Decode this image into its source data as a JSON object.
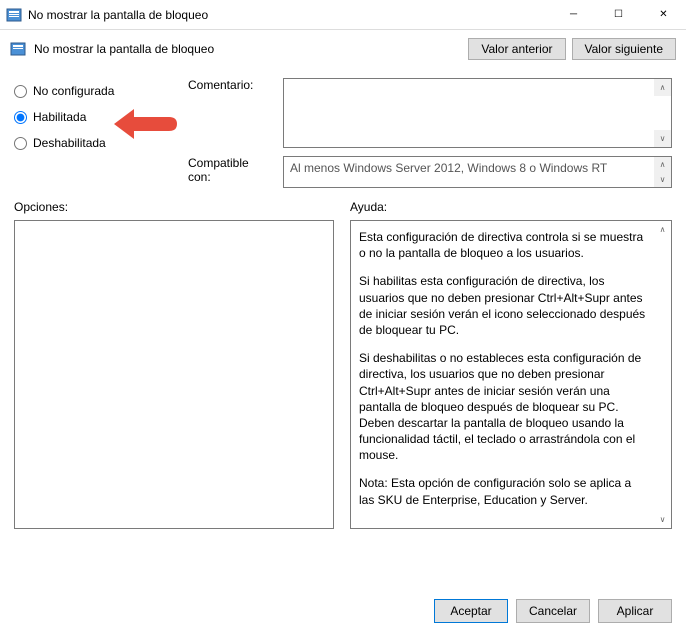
{
  "titlebar": {
    "title": "No mostrar la pantalla de bloqueo"
  },
  "subtitle": {
    "text": "No mostrar la pantalla de bloqueo"
  },
  "nav": {
    "prev": "Valor anterior",
    "next": "Valor siguiente"
  },
  "config": {
    "radio_not_configured": "No configurada",
    "radio_enabled": "Habilitada",
    "radio_disabled": "Deshabilitada",
    "comment_label": "Comentario:",
    "compatible_label": "Compatible con:",
    "compatible_value": "Al menos Windows Server 2012, Windows 8 o Windows RT"
  },
  "lower": {
    "options_label": "Opciones:",
    "help_label": "Ayuda:",
    "help_p1": "Esta configuración de directiva controla si se muestra o no la pantalla de bloqueo a los usuarios.",
    "help_p2": "Si habilitas esta configuración de directiva, los usuarios que no deben presionar Ctrl+Alt+Supr antes de iniciar sesión verán el icono seleccionado después de bloquear tu PC.",
    "help_p3": "Si deshabilitas o no estableces esta configuración de directiva, los usuarios que no deben presionar Ctrl+Alt+Supr antes de iniciar sesión verán una pantalla de bloqueo después de bloquear su PC. Deben descartar la pantalla de bloqueo usando la funcionalidad táctil, el teclado o arrastrándola con el mouse.",
    "help_p4": "Nota: Esta opción de configuración solo se aplica a las SKU de Enterprise, Education y Server."
  },
  "footer": {
    "ok": "Aceptar",
    "cancel": "Cancelar",
    "apply": "Aplicar"
  }
}
